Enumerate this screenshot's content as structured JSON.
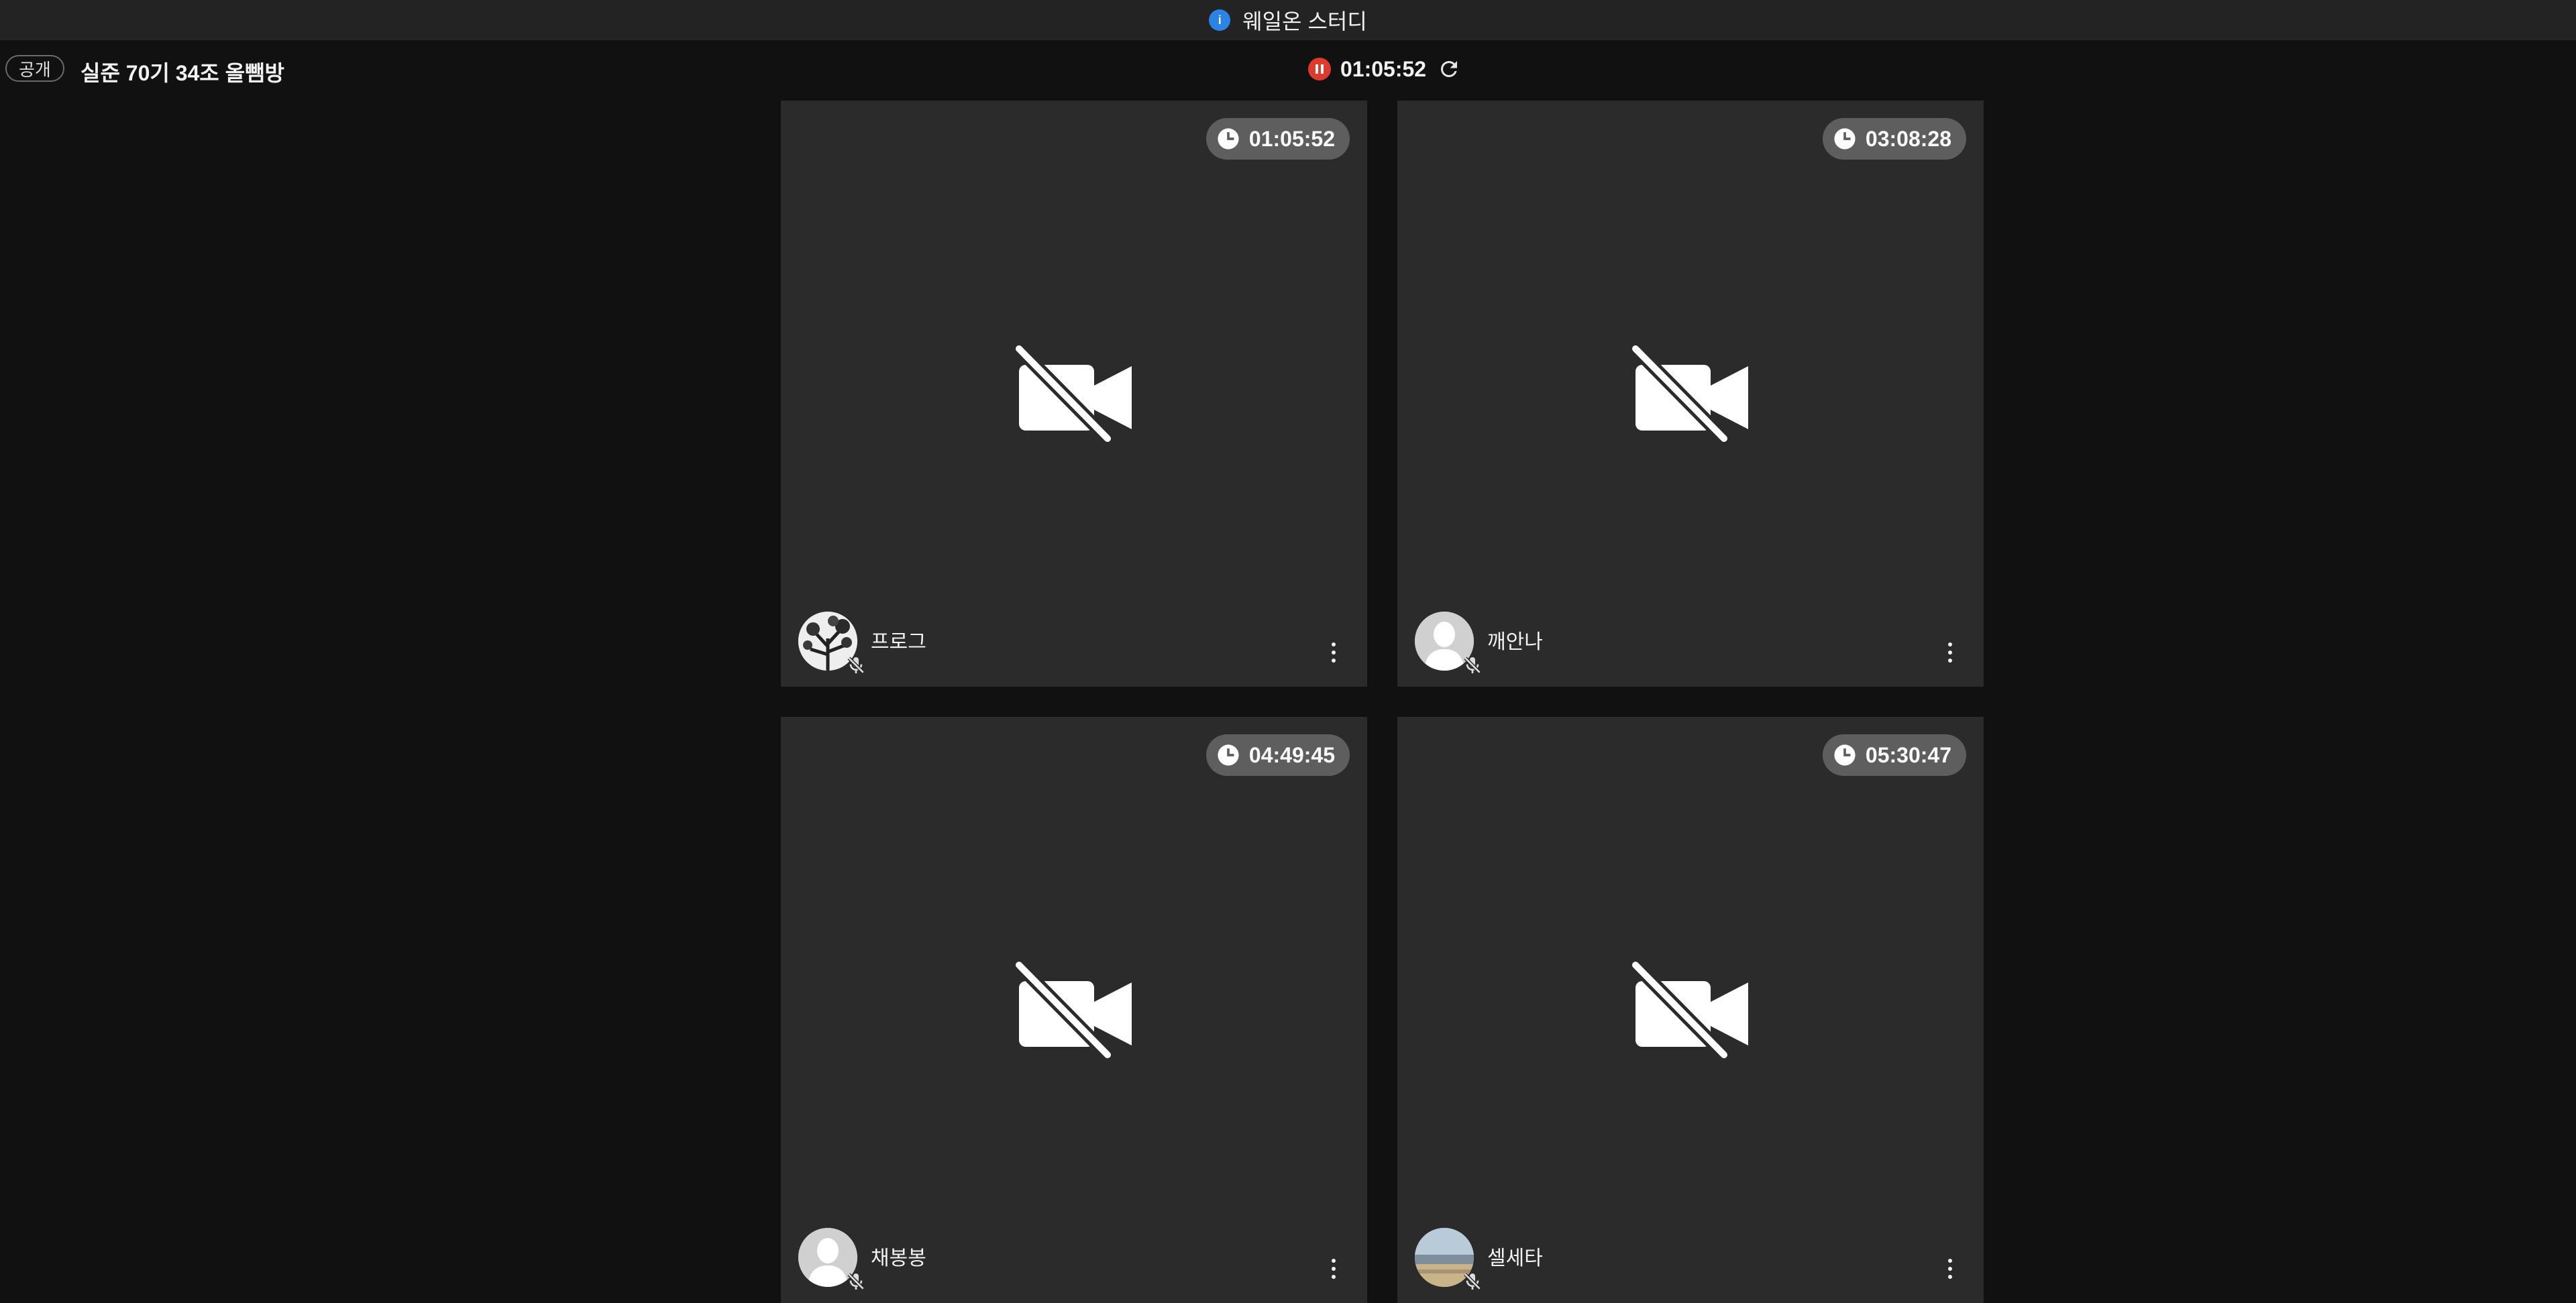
{
  "app": {
    "title": "웨일온 스터디"
  },
  "room": {
    "visibility_badge": "공개",
    "name": "실준 70기 34조 올뺌방",
    "timer": "01:05:52",
    "colors": {
      "pause_button": "#e03a2f",
      "info_icon": "#2b83e6"
    }
  },
  "participants": [
    {
      "name": "프로그",
      "time": "01:05:52",
      "avatar": "tree-photo",
      "video": "off",
      "mic": "muted"
    },
    {
      "name": "깨안나",
      "time": "03:08:28",
      "avatar": "default-person",
      "video": "off",
      "mic": "muted"
    },
    {
      "name": "채봉봉",
      "time": "04:49:45",
      "avatar": "default-person",
      "video": "off",
      "mic": "muted"
    },
    {
      "name": "셀세타",
      "time": "05:30:47",
      "avatar": "landscape-photo",
      "video": "off",
      "mic": "muted"
    }
  ]
}
